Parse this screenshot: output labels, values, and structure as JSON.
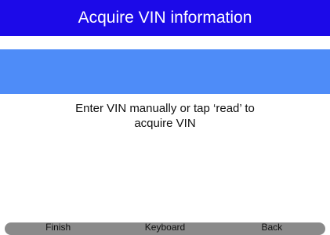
{
  "header": {
    "title": "Acquire VIN information"
  },
  "vin_input": {
    "value": ""
  },
  "instruction": {
    "line1": "Enter VIN manually or tap ‘read’ to",
    "line2": "acquire VIN"
  },
  "toolbar": {
    "finish_label": "Finish",
    "keyboard_label": "Keyboard",
    "back_label": "Back"
  },
  "colors": {
    "title_bar": "#1c0ae8",
    "input_field": "#4e8cf8",
    "bottom_bar": "#8a8a8a"
  }
}
